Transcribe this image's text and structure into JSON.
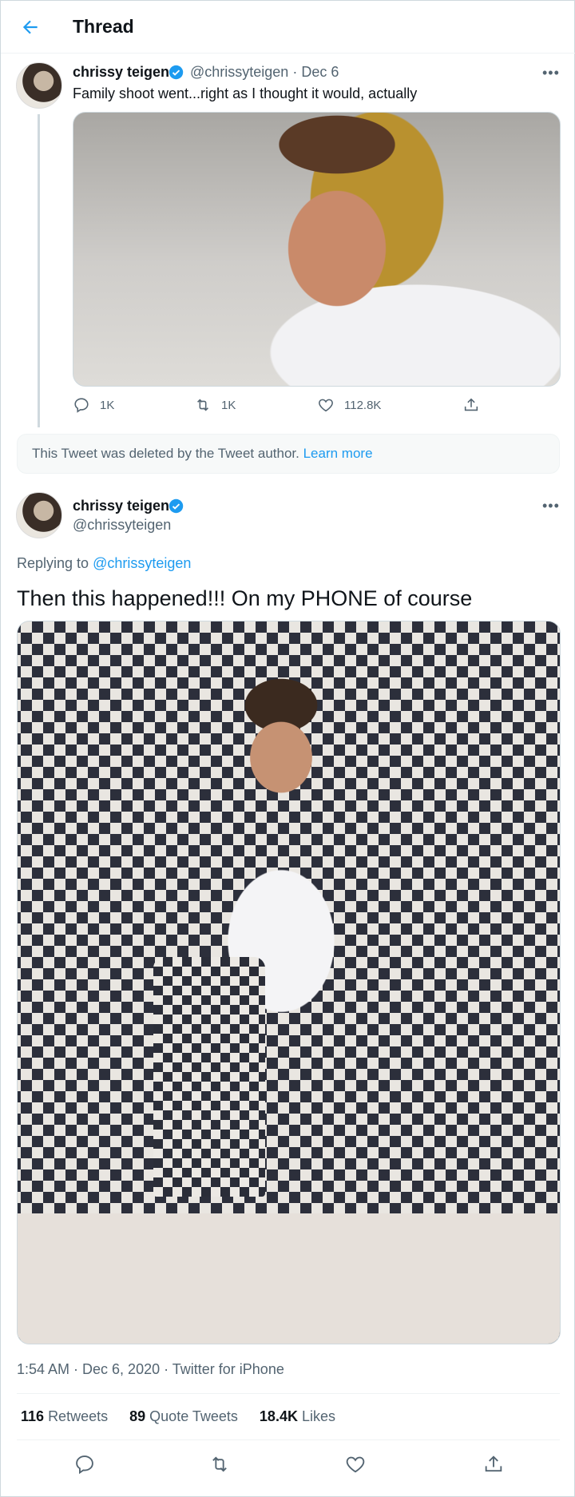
{
  "header": {
    "title": "Thread"
  },
  "tweet1": {
    "name": "chrissy teigen",
    "handle": "@chrissyteigen",
    "date": "Dec 6",
    "separator": "·",
    "text": "Family shoot went...right as I thought it would, actually",
    "more": "•••",
    "actions": {
      "replies": "1K",
      "retweets": "1K",
      "likes": "112.8K"
    }
  },
  "deleted": {
    "text": "This Tweet was deleted by the Tweet author.",
    "link": "Learn more"
  },
  "tweet2": {
    "name": "chrissy teigen",
    "handle": "@chrissyteigen",
    "more": "•••",
    "replying_label": "Replying to",
    "replying_handle": "@chrissyteigen",
    "text": "Then this happened!!! On my PHONE of course",
    "meta": "1:54 AM · Dec 6, 2020 · Twitter for iPhone",
    "stats": {
      "retweets_count": "116",
      "retweets_label": "Retweets",
      "quotes_count": "89",
      "quotes_label": "Quote Tweets",
      "likes_count": "18.4K",
      "likes_label": "Likes"
    }
  },
  "colors": {
    "accent": "#1d9bf0",
    "muted": "#536471",
    "text": "#0f1419"
  },
  "icons": [
    "back-arrow-icon",
    "verified-badge-icon",
    "more-icon",
    "reply-icon",
    "retweet-icon",
    "like-icon",
    "share-icon"
  ]
}
